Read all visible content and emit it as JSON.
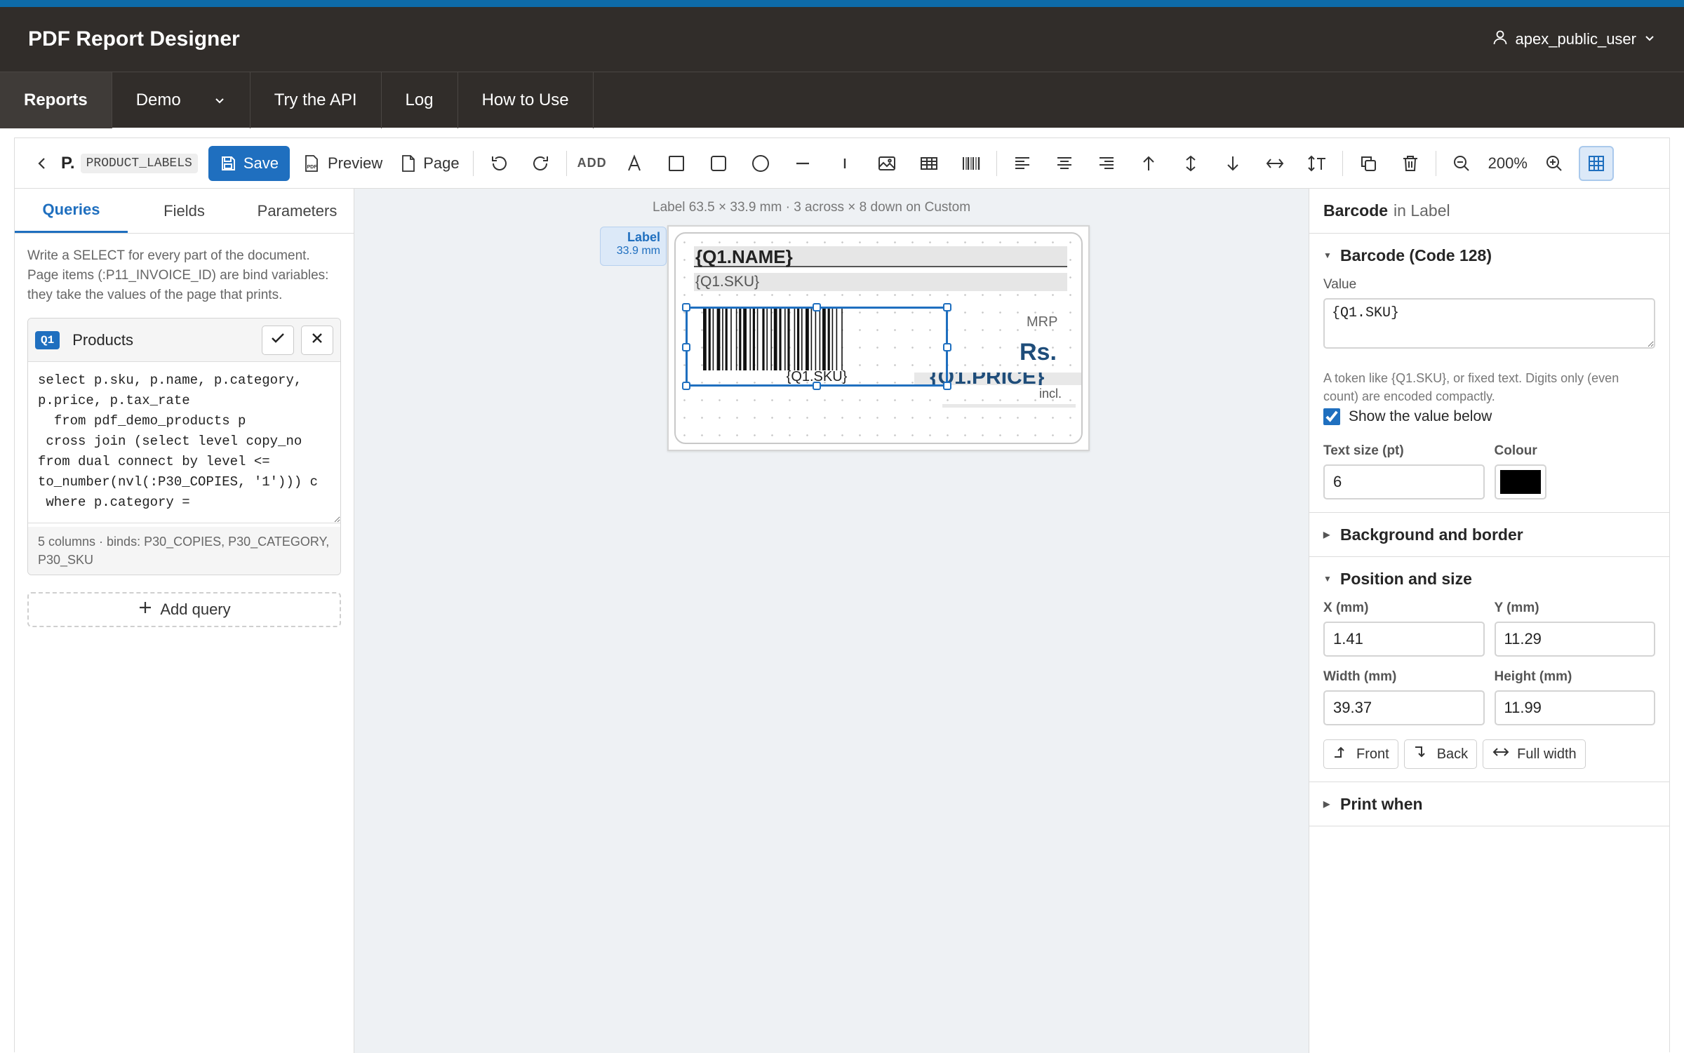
{
  "app": {
    "title": "PDF Report Designer",
    "user": "apex_public_user"
  },
  "nav": {
    "items": [
      {
        "label": "Reports",
        "active": true
      },
      {
        "label": "Demo",
        "has_dropdown": true
      },
      {
        "label": "Try the API"
      },
      {
        "label": "Log"
      },
      {
        "label": "How to Use"
      }
    ]
  },
  "toolbar": {
    "doc_short": "P.",
    "doc_code": "PRODUCT_LABELS",
    "save_label": "Save",
    "preview_label": "Preview",
    "page_label": "Page",
    "add_label": "ADD",
    "zoom": "200%"
  },
  "left": {
    "tabs": [
      "Queries",
      "Fields",
      "Parameters"
    ],
    "active_tab": "Queries",
    "intro": "Write a SELECT for every part of the document. Page items (:P11_INVOICE_ID) are bind variables: they take the values of the page that prints.",
    "query": {
      "badge": "Q1",
      "name": "Products",
      "sql": "select p.sku, p.name, p.category, p.price, p.tax_rate\n  from pdf_demo_products p\n cross join (select level copy_no from dual connect by level <= to_number(nvl(:P30_COPIES, '1'))) c\n where p.category =",
      "footer": "5 columns · binds: P30_COPIES, P30_CATEGORY, P30_SKU"
    },
    "add_query_label": "Add query"
  },
  "canvas": {
    "caption": "Label 63.5 × 33.9 mm · 3 across × 8 down on Custom",
    "band_label": "Label",
    "band_height": "33.9 mm",
    "fields": {
      "name": "{Q1.NAME}",
      "sku": "{Q1.SKU}",
      "barcode_text": "{Q1.SKU}",
      "mrp": "MRP",
      "rs": "Rs.",
      "price": "{Q1.PRICE}",
      "incl": "incl."
    }
  },
  "right": {
    "title_type": "Barcode",
    "title_context": "in Label",
    "barcode_section": "Barcode (Code 128)",
    "value_label": "Value",
    "value": "{Q1.SKU}",
    "help": "A token like {Q1.SKU}, or fixed text. Digits only (even count) are encoded compactly.",
    "show_value_label": "Show the value below",
    "show_value_checked": true,
    "text_size_label": "Text size (pt)",
    "text_size": "6",
    "colour_label": "Colour",
    "colour": "#000000",
    "bg_section": "Background and border",
    "pos_section": "Position and size",
    "x_label": "X (mm)",
    "x": "1.41",
    "y_label": "Y (mm)",
    "y": "11.29",
    "w_label": "Width (mm)",
    "w": "39.37",
    "h_label": "Height (mm)",
    "h": "11.99",
    "front_label": "Front",
    "back_label": "Back",
    "fullwidth_label": "Full width",
    "print_when_section": "Print when"
  },
  "colors": {
    "accent": "#1f6fbf",
    "header": "#312d2a",
    "topstrip": "#0e6ba8",
    "canvas": "#eef1f4"
  }
}
